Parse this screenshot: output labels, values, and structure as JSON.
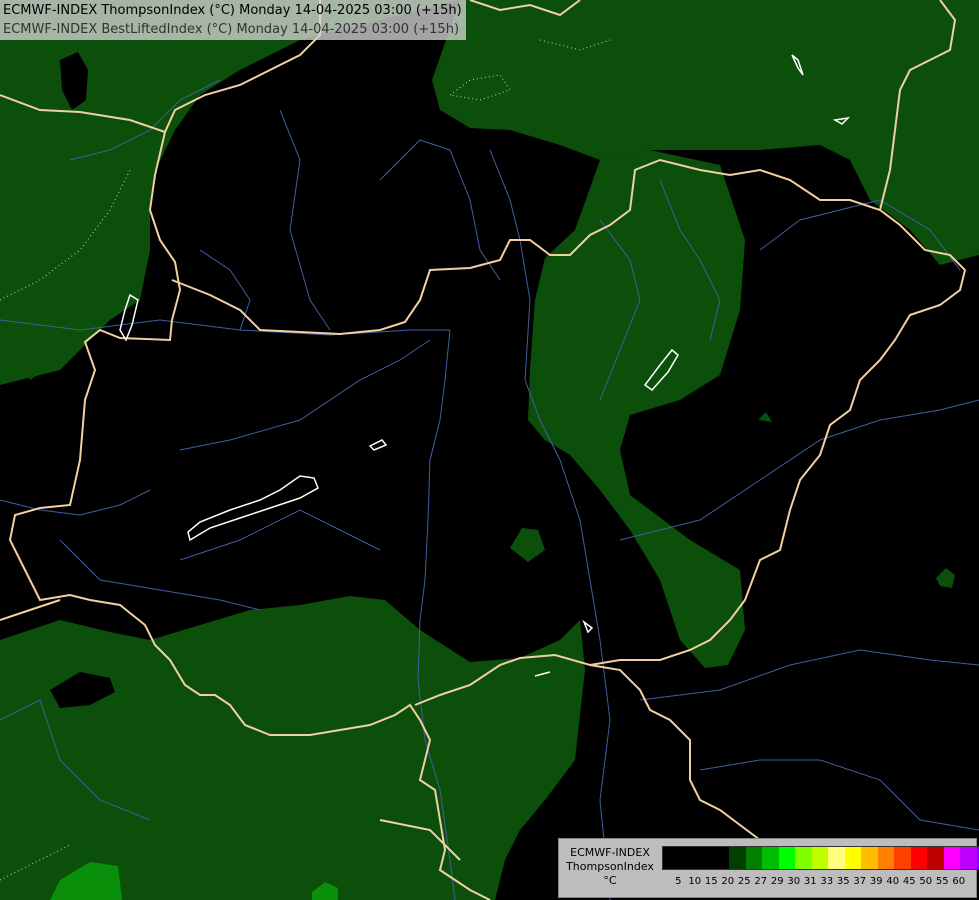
{
  "header": {
    "line1": "ECMWF-INDEX ThompsonIndex (°C) Monday 14-04-2025 03:00 (+15h)",
    "line2": "ECMWF-INDEX BestLiftedIndex (°C) Monday 14-04-2025 03:00 (+15h)"
  },
  "legend": {
    "model": "ECMWF-INDEX",
    "parameter": "ThompsonIndex",
    "unit": "°C",
    "ticks": [
      "5",
      "10",
      "15",
      "20",
      "25",
      "27",
      "29",
      "30",
      "31",
      "33",
      "35",
      "37",
      "39",
      "40",
      "45",
      "50",
      "55",
      "60"
    ],
    "colors": [
      "#000000",
      "#000000",
      "#000000",
      "#000000",
      "#003f00",
      "#007f00",
      "#00bf00",
      "#00ff00",
      "#7fff00",
      "#bfff00",
      "#ffff7f",
      "#ffff00",
      "#ffbf00",
      "#ff7f00",
      "#ff3f00",
      "#ff0000",
      "#bf0000",
      "#ff00ff",
      "#bf00ff",
      "#7f00ff",
      "#5500ff",
      "#0000ff"
    ]
  },
  "colors": {
    "background": "#000000",
    "green_area": "#0b4f0b",
    "bright_green": "#0a8f0a",
    "borders": "#f1cfa3",
    "rivers": "#3f5f9e",
    "contour": "#ffffff"
  }
}
